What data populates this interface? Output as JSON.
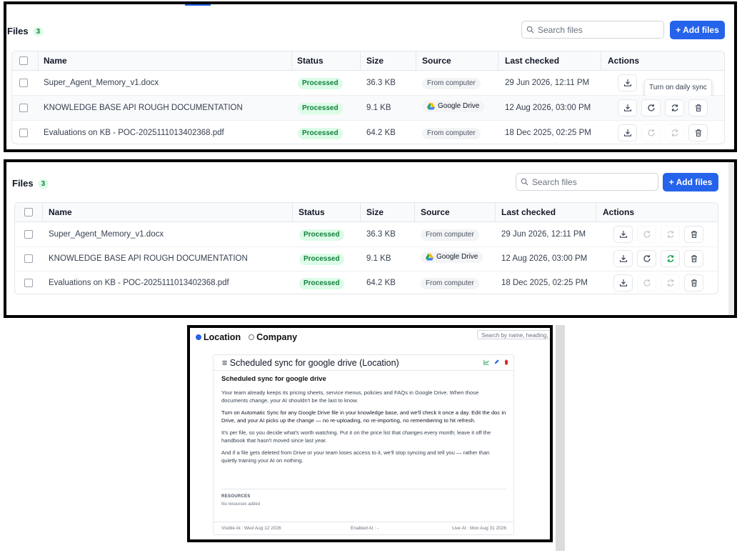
{
  "files_view_top": {
    "header": {
      "title": "Files",
      "count": "3"
    },
    "search": {
      "placeholder": "Search files"
    },
    "add_button": {
      "label": "+ Add files"
    },
    "columns": [
      "Name",
      "Status",
      "Size",
      "Source",
      "Last checked",
      "Actions"
    ],
    "rows": [
      {
        "name": "Super_Agent_Memory_v1.docx",
        "status": "Processed",
        "size": "36.3 KB",
        "source": "From computer",
        "last_checked": "29 Jun 2026, 12:11 PM"
      },
      {
        "name": "KNOWLEDGE BASE API ROUGH DOCUMENTATION",
        "status": "Processed",
        "size": "9.1 KB",
        "source": "Google Drive",
        "last_checked": "12 Aug 2026, 03:00 PM"
      },
      {
        "name": "Evaluations on KB - POC-2025111013402368.pdf",
        "status": "Processed",
        "size": "64.2 KB",
        "source": "From computer",
        "last_checked": "18 Dec 2025, 02:25 PM"
      }
    ],
    "tooltip": "Turn on daily sync"
  },
  "files_view_bottom": {
    "header": {
      "title": "Files",
      "count": "3"
    },
    "search": {
      "placeholder": "Search files"
    },
    "add_button": {
      "label": "+ Add files"
    },
    "columns": [
      "Name",
      "Status",
      "Size",
      "Source",
      "Last checked",
      "Actions"
    ],
    "rows": [
      {
        "name": "Super_Agent_Memory_v1.docx",
        "status": "Processed",
        "size": "36.3 KB",
        "source": "From computer",
        "last_checked": "29 Jun 2026, 12:11 PM"
      },
      {
        "name": "KNOWLEDGE BASE API ROUGH DOCUMENTATION",
        "status": "Processed",
        "size": "9.1 KB",
        "source": "Google Drive",
        "last_checked": "12 Aug 2026, 03:00 PM"
      },
      {
        "name": "Evaluations on KB - POC-2025111013402368.pdf",
        "status": "Processed",
        "size": "64.2 KB",
        "source": "From computer",
        "last_checked": "18 Dec 2025, 02:25 PM"
      }
    ]
  },
  "changelog": {
    "scope_options": [
      "Location",
      "Company"
    ],
    "selected_scope": "Location",
    "search_placeholder": "Search by name, heading, ke",
    "card_title": "Scheduled sync for google drive (Location)",
    "heading": "Scheduled sync for google drive",
    "paragraphs": [
      "Your team already keeps its pricing sheets, service menus, policies and FAQs in Google Drive. When those documents change, your AI shouldn't be the last to know.",
      "Turn on Automatic Sync for any Google Drive file in your knowledge base, and we'll check it once a day. Edit the doc in Drive, and your AI picks up the change — no re-uploading, no re-importing, no remembering to hit refresh.",
      "It's per file, so you decide what's worth watching. Put it on the price list that changes every month; leave it off the handbook that hasn't moved since last year.",
      "And if a file gets deleted from Drive or your team loses access to it, we'll stop syncing and tell you — rather than quietly training your AI on nothing."
    ],
    "resources_label": "RESOURCES",
    "resources_empty": "No resources added",
    "visible_at": "Visible At : Wed Aug 12 2026",
    "enabled_at": "Enabled At : -",
    "live_at": "Live At : Mon Aug 31 2026"
  },
  "colors": {
    "accent": "#2563eb",
    "success": "#15803d",
    "success_bg": "#dcfce7",
    "delete": "#dc2626"
  }
}
